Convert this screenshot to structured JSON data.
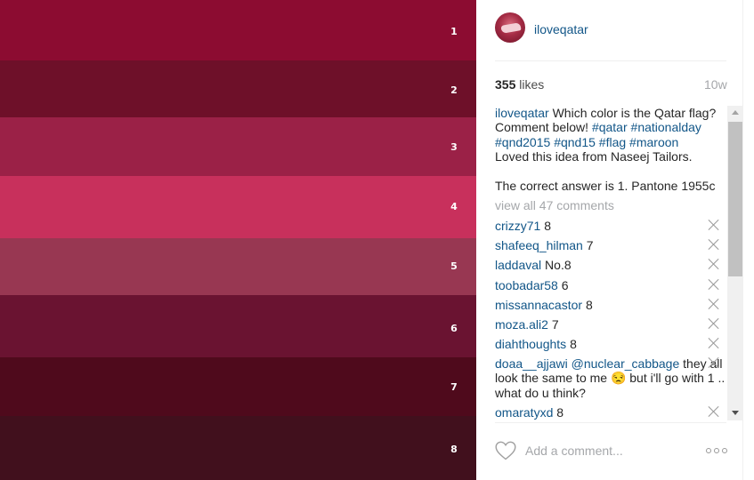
{
  "photo": {
    "swatches": [
      {
        "label": "1",
        "color": "#8c0c31"
      },
      {
        "label": "2",
        "color": "#6e1029"
      },
      {
        "label": "3",
        "color": "#9b2147"
      },
      {
        "label": "4",
        "color": "#c8305c"
      },
      {
        "label": "5",
        "color": "#983752"
      },
      {
        "label": "6",
        "color": "#6a1331"
      },
      {
        "label": "7",
        "color": "#4f0a1c"
      },
      {
        "label": "8",
        "color": "#41101d"
      }
    ]
  },
  "post": {
    "username": "iloveqatar",
    "likes_count": "355",
    "likes_word": "likes",
    "age": "10w"
  },
  "caption": {
    "username": "iloveqatar",
    "text_1": "Which color is the Qatar flag? Comment below!",
    "tags_1": [
      "#qatar",
      "#nationalday",
      "#qnd2015",
      "#qnd15",
      "#flag",
      "#maroon"
    ],
    "text_2": "Loved this idea from Naseej Tailors.",
    "text_3": "The correct answer is 1. Pantone 1955c"
  },
  "view_all": "view all 47 comments",
  "comments": [
    {
      "user": "crizzy71",
      "text": "8"
    },
    {
      "user": "shafeeq_hilman",
      "text": "7"
    },
    {
      "user": "laddaval",
      "text": "No.8"
    },
    {
      "user": "toobadar58",
      "text": "6"
    },
    {
      "user": "missannacastor",
      "text": "8"
    },
    {
      "user": "moza.ali2",
      "text": "7"
    },
    {
      "user": "diahthoughts",
      "text": "8"
    },
    {
      "user": "doaa__ajjawi",
      "mention": "@nuclear_cabbage",
      "text": "they all look the same to me 😒 but i'll go with 1 .. what do u think?"
    },
    {
      "user": "omaratyxd",
      "text": "8"
    }
  ],
  "footer": {
    "add_comment_placeholder": "Add a comment..."
  },
  "colors": {
    "link": "#125688",
    "muted": "#a5a7aa",
    "text": "#262626"
  },
  "icons": [
    "heart-icon",
    "more-options-icon",
    "delete-comment-icon",
    "scroll-up-arrow-icon",
    "scroll-down-arrow-icon"
  ]
}
